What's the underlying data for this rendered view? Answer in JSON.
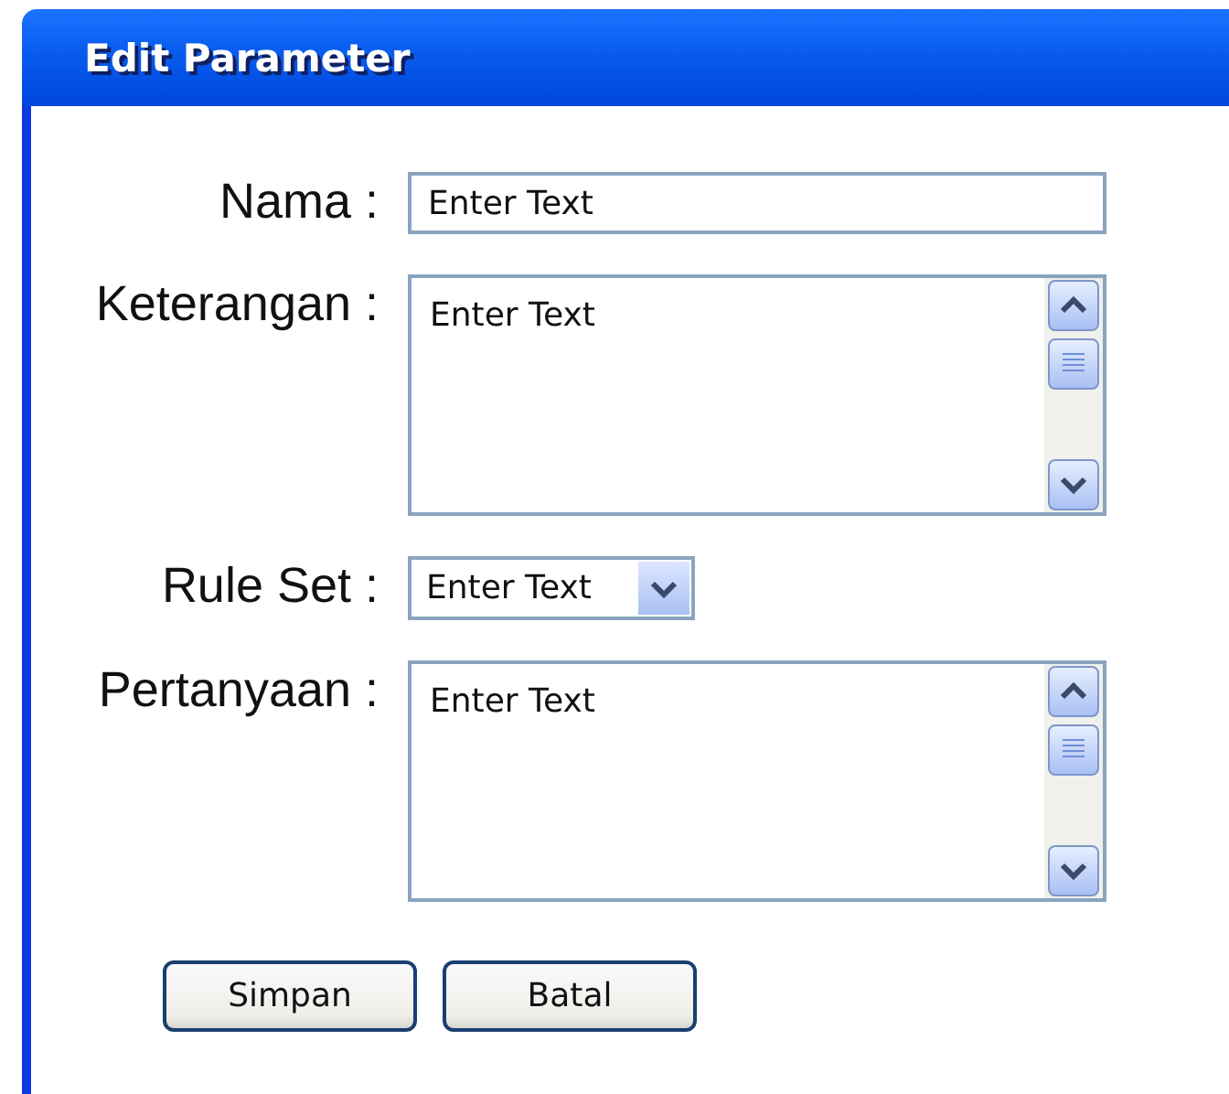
{
  "window": {
    "title": "Edit Parameter"
  },
  "form": {
    "fields": [
      {
        "kind": "text",
        "label": "Nama :",
        "value": "Enter Text"
      },
      {
        "kind": "textarea",
        "label": "Keterangan :",
        "value": "Enter Text"
      },
      {
        "kind": "dropdown",
        "label": "Rule Set :",
        "value": "Enter Text"
      },
      {
        "kind": "textarea",
        "label": "Pertanyaan :",
        "value": "Enter Text"
      }
    ]
  },
  "buttons": [
    "Simpan",
    "Batal"
  ]
}
